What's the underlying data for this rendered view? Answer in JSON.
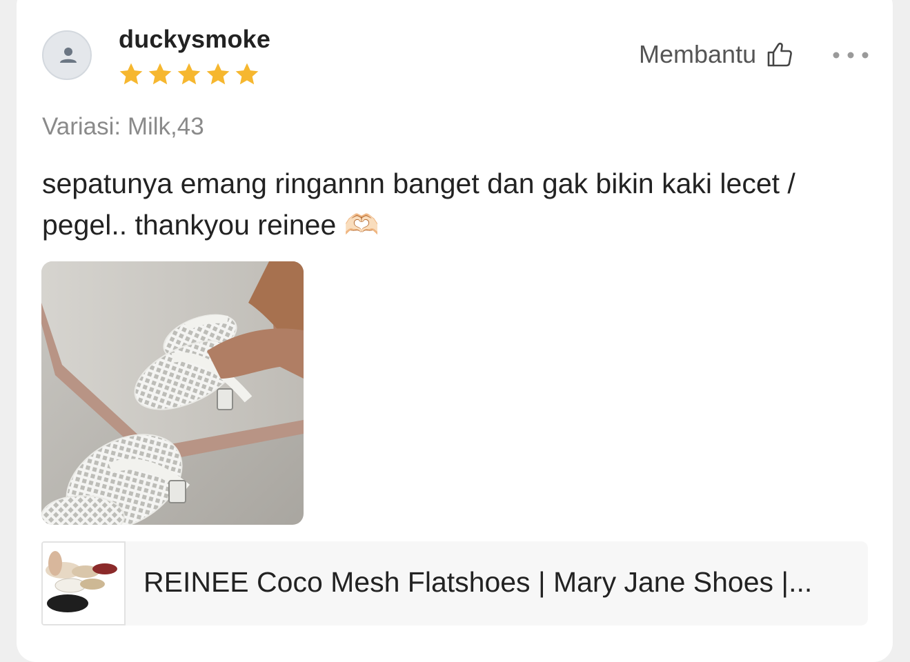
{
  "review": {
    "username": "duckysmoke",
    "rating": 5,
    "helpful_label": "Membantu",
    "variation": "Variasi: Milk,43",
    "text": "sepatunya emang ringannn banget dan gak bikin kaki lecet / pegel.. thankyou reinee",
    "text_emoji": "🫶🏻"
  },
  "product": {
    "name": "REINEE Coco Mesh Flatshoes | Mary Jane Shoes |..."
  },
  "colors": {
    "star": "#f6b72f",
    "text": "#222222",
    "muted": "#8a8a8a",
    "card_bg": "#ffffff",
    "page_bg": "#efefef"
  },
  "icons": {
    "avatar": "user-placeholder-icon",
    "helpful": "thumbs-up-icon",
    "more": "more-dots-icon",
    "star": "star-icon"
  }
}
